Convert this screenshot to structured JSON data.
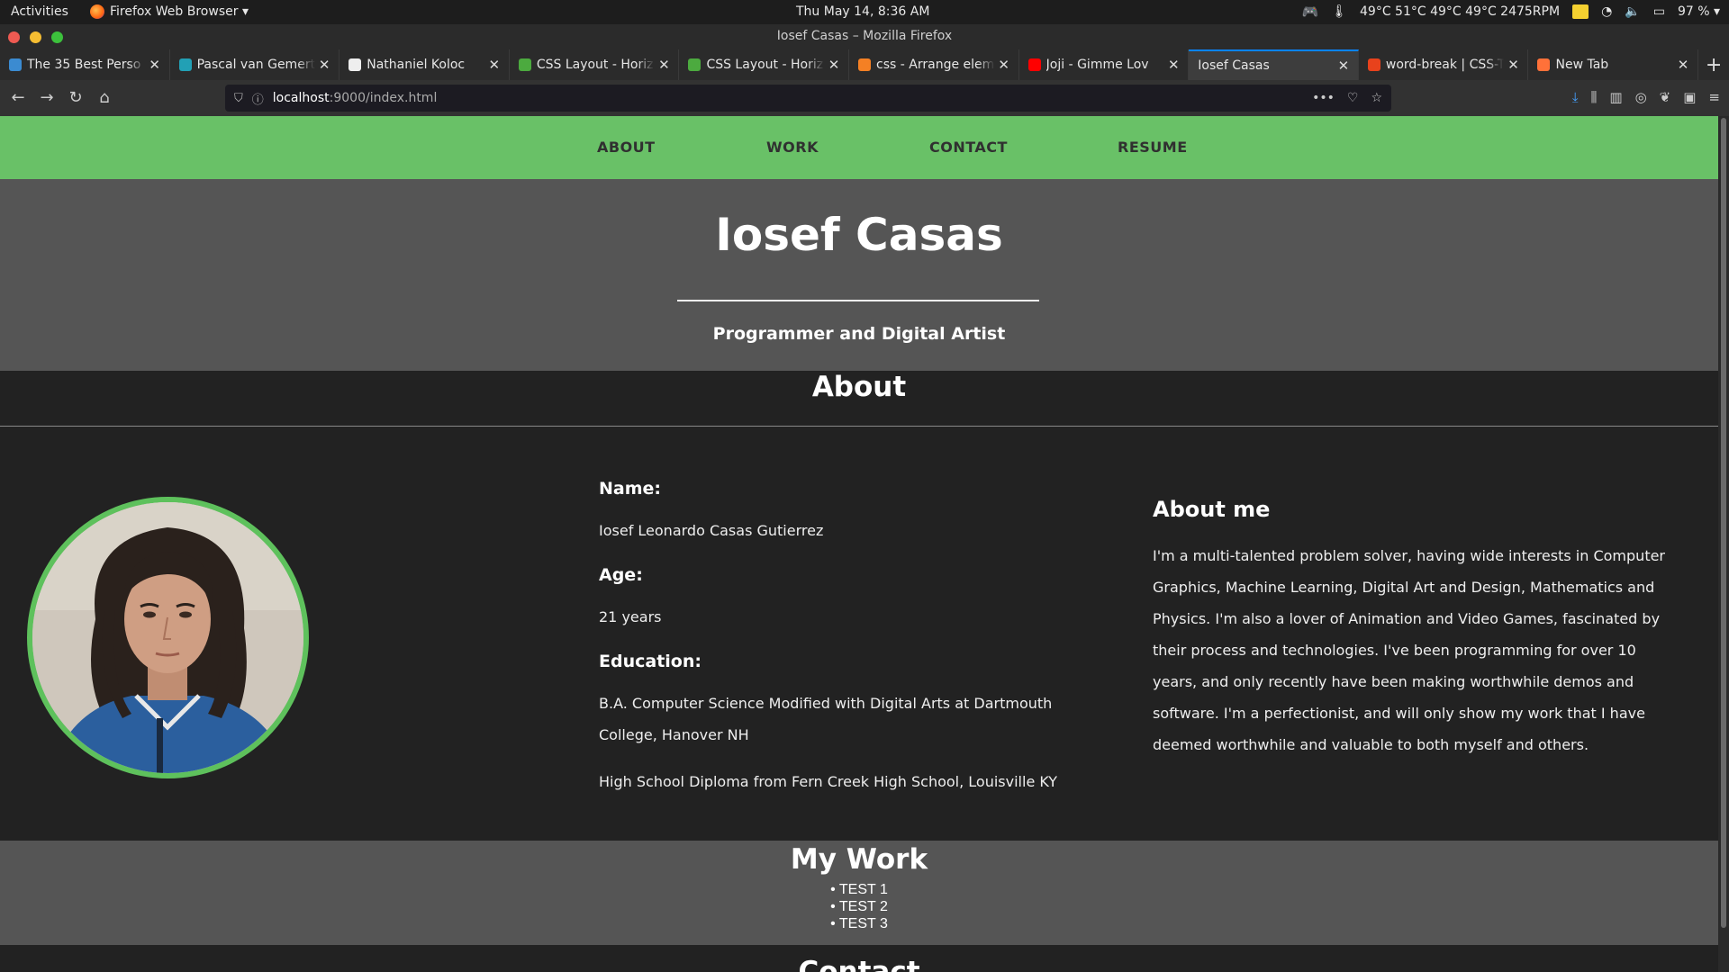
{
  "system_bar": {
    "activities": "Activities",
    "app_menu": "Firefox Web Browser ▾",
    "clock": "Thu May 14,  8:36 AM",
    "sensors": "49°C 51°C 49°C 49°C 2475RPM",
    "battery": "97 % ▾"
  },
  "window": {
    "title": "Iosef Casas – Mozilla Firefox"
  },
  "tabs": [
    {
      "label": "The 35 Best Perso",
      "favicon_color": "#3b8bd1"
    },
    {
      "label": "Pascal van Gemert",
      "favicon_color": "#22a0b5"
    },
    {
      "label": "Nathaniel Koloc",
      "favicon_color": "#eeeeee"
    },
    {
      "label": "CSS Layout - Horiz",
      "favicon_color": "#4caa3f"
    },
    {
      "label": "CSS Layout - Horiz",
      "favicon_color": "#4caa3f"
    },
    {
      "label": "css - Arrange elem",
      "favicon_color": "#f48024"
    },
    {
      "label": "Joji - Gimme Lov",
      "favicon_color": "#ff0000"
    },
    {
      "label": "Iosef Casas",
      "favicon_color": "",
      "active": true
    },
    {
      "label": "word-break | CSS-T",
      "favicon_color": "#e8421c"
    },
    {
      "label": "New Tab",
      "favicon_color": "#ff7139"
    }
  ],
  "url": {
    "host": "localhost",
    "path": ":9000/index.html"
  },
  "site": {
    "nav": [
      "ABOUT",
      "WORK",
      "CONTACT",
      "RESUME"
    ],
    "name": "Iosef Casas",
    "subtitle": "Programmer and Digital Artist",
    "about_heading": "About",
    "name_label": "Name:",
    "name_value": "Iosef Leonardo Casas Gutierrez",
    "age_label": "Age:",
    "age_value": "21 years",
    "education_label": "Education:",
    "education_1": "B.A. Computer Science Modified with Digital Arts at Dartmouth College, Hanover NH",
    "education_2": "High School Diploma from Fern Creek High School, Louisville KY",
    "aboutme_heading": "About me",
    "aboutme_text": "I'm a multi-talented problem solver, having wide interests in Computer Graphics, Machine Learning, Digital Art and Design, Mathematics and Physics. I'm also a lover of Animation and Video Games, fascinated by their process and technologies. I've been programming for over 10 years, and only recently have been making worthwhile demos and software. I'm a perfectionist, and will only show my work that I have deemed worthwhile and valuable to both myself and others.",
    "work_heading": "My Work",
    "work_items": [
      "TEST 1",
      "TEST 2",
      "TEST 3"
    ],
    "contact_heading": "Contact"
  },
  "colors": {
    "nav_green": "#69c167",
    "hero_gray": "#555555",
    "dark_bg": "#222222",
    "avatar_ring": "#5ec15c"
  }
}
